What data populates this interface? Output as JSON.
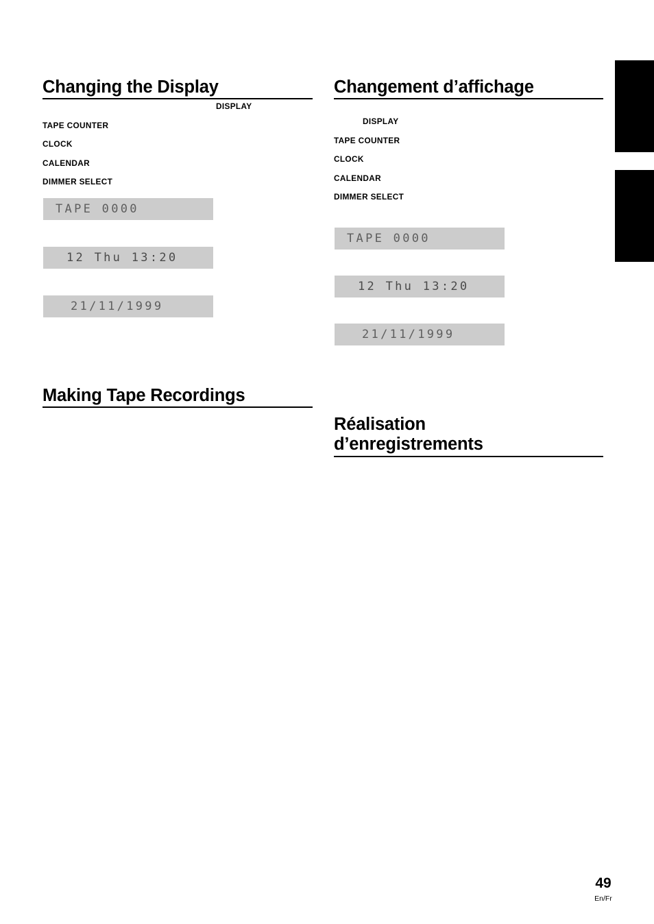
{
  "page": {
    "number": "49",
    "locale": "En/Fr"
  },
  "edge_tabs": [
    {
      "name": "chapter-tab-upper"
    },
    {
      "name": "chapter-tab-lower"
    }
  ],
  "english_column": {
    "headings": {
      "changing_display": "Changing the Display",
      "making_recordings": "Making Tape Recordings"
    },
    "flow_items": [
      "DISPLAY",
      "TAPE COUNTER",
      "CLOCK",
      "CALENDAR",
      "DIMMER SELECT"
    ],
    "displays": [
      {
        "label": "tape-counter",
        "text": "TAPE 0000"
      },
      {
        "label": "clock",
        "text": "12 Thu 13:20"
      },
      {
        "label": "calendar",
        "text": "21/11/1999"
      }
    ]
  },
  "french_column": {
    "headings": {
      "changement_affichage": "Changement d’affichage",
      "realisation": "Réalisation\nd’enregistrements"
    },
    "flow_items": [
      "DISPLAY",
      "TAPE COUNTER",
      "CLOCK",
      "CALENDAR",
      "DIMMER SELECT"
    ],
    "displays": [
      {
        "label": "tape-counter",
        "text": "TAPE 0000"
      },
      {
        "label": "clock",
        "text": "12 Thu 13:20"
      },
      {
        "label": "calendar",
        "text": "21/11/1999"
      }
    ]
  },
  "colors": {
    "lcd_background": "#cccccc",
    "lcd_pixel": "#5e5e5e",
    "ink": "#000000",
    "paper": "#ffffff"
  }
}
